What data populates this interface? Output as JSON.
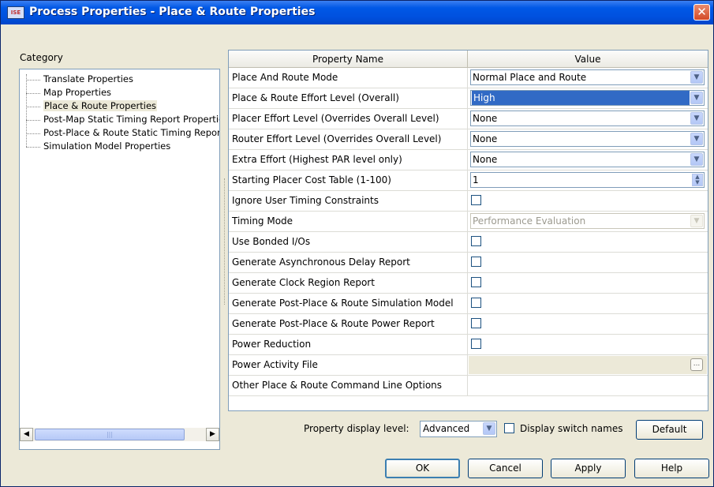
{
  "window": {
    "title": "Process Properties - Place & Route Properties",
    "icon_text": "ISE",
    "close_glyph": "✕"
  },
  "category": {
    "label": "Category",
    "items": [
      "Translate Properties",
      "Map Properties",
      "Place & Route Properties",
      "Post-Map Static Timing Report Properties",
      "Post-Place & Route Static Timing Report Properties",
      "Simulation Model Properties"
    ],
    "selected_index": 2,
    "scroll_left_glyph": "◀",
    "scroll_right_glyph": "▶",
    "thumb_grip": "|||"
  },
  "grid": {
    "headers": [
      "Property Name",
      "Value"
    ],
    "rows": [
      {
        "name": "Place And Route Mode",
        "type": "combo",
        "value": "Normal Place and Route"
      },
      {
        "name": "Place & Route Effort Level (Overall)",
        "type": "combo-selected",
        "value": "High"
      },
      {
        "name": "Placer Effort Level (Overrides Overall Level)",
        "type": "combo",
        "value": "None"
      },
      {
        "name": "Router Effort Level (Overrides Overall Level)",
        "type": "combo",
        "value": "None"
      },
      {
        "name": "Extra Effort (Highest PAR level only)",
        "type": "combo",
        "value": "None"
      },
      {
        "name": "Starting Placer Cost Table (1-100)",
        "type": "spin",
        "value": "1"
      },
      {
        "name": "Ignore User Timing Constraints",
        "type": "checkbox",
        "checked": false
      },
      {
        "name": "Timing Mode",
        "type": "combo-disabled",
        "value": "Performance Evaluation"
      },
      {
        "name": "Use Bonded I/Os",
        "type": "checkbox",
        "checked": false
      },
      {
        "name": "Generate Asynchronous Delay Report",
        "type": "checkbox",
        "checked": false
      },
      {
        "name": "Generate Clock Region Report",
        "type": "checkbox",
        "checked": false
      },
      {
        "name": "Generate Post-Place & Route Simulation Model",
        "type": "checkbox",
        "checked": false
      },
      {
        "name": "Generate Post-Place & Route Power Report",
        "type": "checkbox",
        "checked": false
      },
      {
        "name": "Power Reduction",
        "type": "checkbox",
        "checked": false
      },
      {
        "name": "Power Activity File",
        "type": "file-disabled",
        "value": ""
      },
      {
        "name": "Other Place & Route Command Line Options",
        "type": "text",
        "value": ""
      }
    ]
  },
  "footer": {
    "display_level_label": "Property display level:",
    "display_level_value": "Advanced",
    "display_switch_label": "Display switch names",
    "display_switch_checked": false,
    "default_label": "Default",
    "ok_label": "OK",
    "cancel_label": "Cancel",
    "apply_label": "Apply",
    "help_label": "Help"
  },
  "colors": {
    "title_gradient_start": "#3b80f2",
    "title_gradient_end": "#0045c8",
    "selection": "#316ac5",
    "dialog_bg": "#ece9d8"
  }
}
